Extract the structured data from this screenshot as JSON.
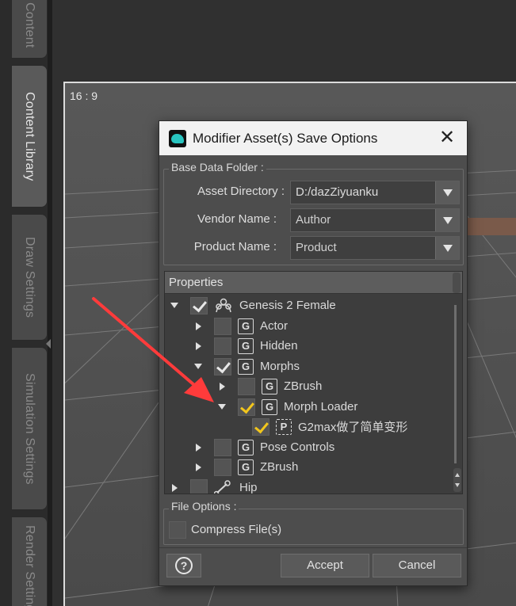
{
  "left_tabs": [
    {
      "label": "Content",
      "active": false
    },
    {
      "label": "Content Library",
      "active": true
    },
    {
      "label": "Draw Settings",
      "active": false
    },
    {
      "label": "Simulation Settings",
      "active": false
    },
    {
      "label": "Render Settings",
      "active": false
    }
  ],
  "viewport": {
    "aspect_label": "16 : 9"
  },
  "dialog": {
    "title": "Modifier Asset(s) Save Options",
    "close_glyph": "✕",
    "base_group_label": "Base Data Folder :",
    "fields": [
      {
        "label": "Asset Directory :",
        "value": "D:/dazZiyuanku"
      },
      {
        "label": "Vendor Name :",
        "value": "Author"
      },
      {
        "label": "Product Name :",
        "value": "Product"
      }
    ],
    "properties_header": "Properties",
    "tree": [
      {
        "label": "Genesis 2 Female",
        "arrow": "down",
        "checked": true,
        "check_color": "white",
        "icon": "figure-icon"
      },
      {
        "label": "Actor",
        "arrow": "right",
        "checked": false,
        "icon": "G"
      },
      {
        "label": "Hidden",
        "arrow": "right",
        "checked": false,
        "icon": "G"
      },
      {
        "label": "Morphs",
        "arrow": "down",
        "checked": true,
        "check_color": "white",
        "icon": "G"
      },
      {
        "label": "ZBrush",
        "arrow": "right",
        "checked": false,
        "icon": "G"
      },
      {
        "label": "Morph Loader",
        "arrow": "down",
        "checked": true,
        "check_color": "yellow",
        "icon": "G"
      },
      {
        "label": "G2max做了简单变形",
        "arrow": "none",
        "checked": true,
        "check_color": "yellow",
        "icon": "P"
      },
      {
        "label": "Pose Controls",
        "arrow": "right",
        "checked": false,
        "icon": "G"
      },
      {
        "label": "ZBrush",
        "arrow": "right",
        "checked": false,
        "icon": "G"
      },
      {
        "label": "Hip",
        "arrow": "right",
        "checked": false,
        "icon": "bone-icon"
      }
    ],
    "file_options_label": "File Options :",
    "compress_label": "Compress File(s)",
    "help_glyph": "?",
    "accept_label": "Accept",
    "cancel_label": "Cancel"
  },
  "colors": {
    "accent_check": "#f2c61c",
    "annotation_arrow": "#ff3b3b",
    "dialog_bg": "#4d4d4d",
    "titlebar_bg": "#f2f2f2"
  }
}
